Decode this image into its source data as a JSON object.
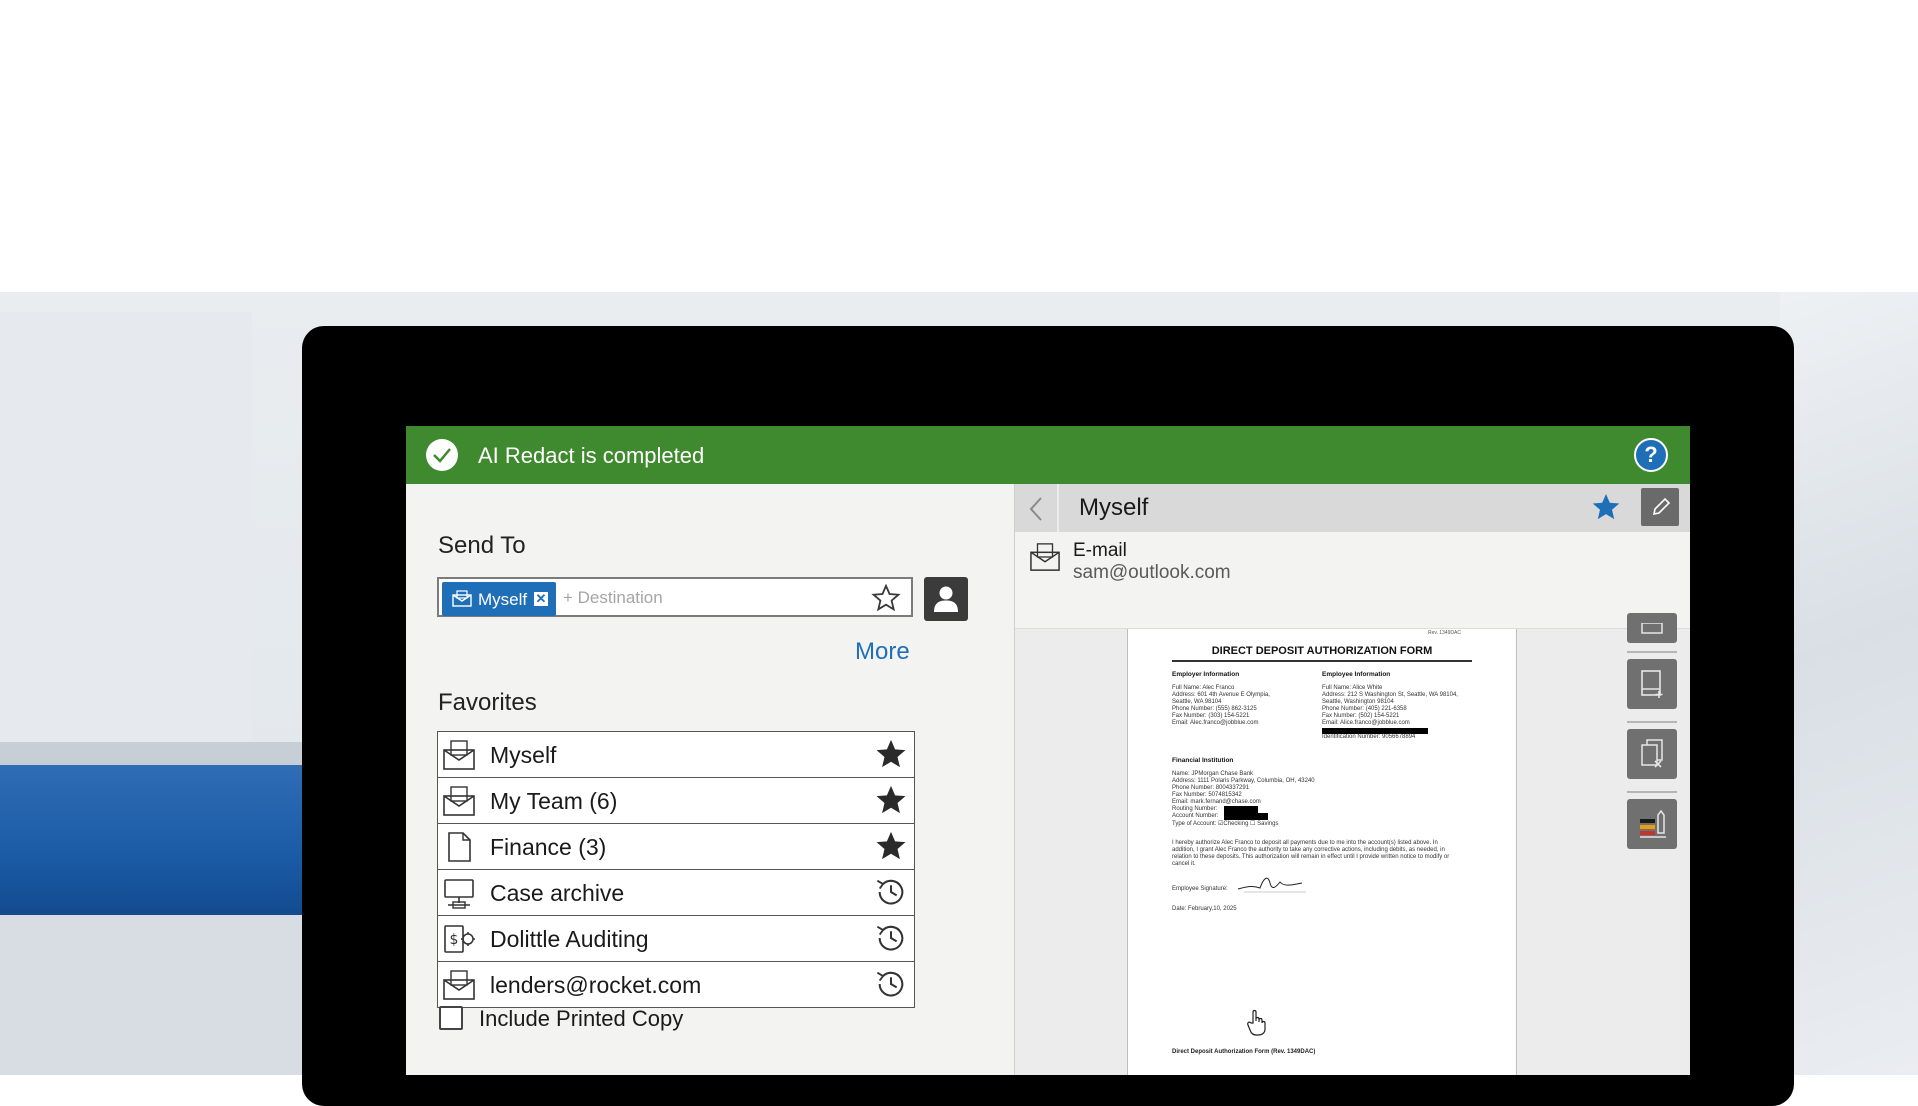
{
  "banner": {
    "message": "AI Redact is completed",
    "help_symbol": "?",
    "icon": "check-circle-icon",
    "color": "#3f8a2f"
  },
  "send_to": {
    "title": "Send To",
    "chip_label": "Myself",
    "chip_remove_symbol": "✕",
    "placeholder": "+ Destination",
    "more_label": "More"
  },
  "favorites": {
    "title": "Favorites",
    "items": [
      {
        "name": "Myself",
        "icon": "email-icon",
        "tail": "star-filled-icon"
      },
      {
        "name": "My Team (6)",
        "icon": "email-icon",
        "tail": "star-filled-icon"
      },
      {
        "name": "Finance (3)",
        "icon": "document-icon",
        "tail": "star-filled-icon"
      },
      {
        "name": "Case archive",
        "icon": "network-folder-icon",
        "tail": "history-icon"
      },
      {
        "name": "Dolittle Auditing",
        "icon": "payment-icon",
        "tail": "history-icon"
      },
      {
        "name": "lenders@rocket.com",
        "icon": "email-icon",
        "tail": "history-icon"
      }
    ]
  },
  "include_printed_copy": {
    "label": "Include Printed Copy",
    "checked": false
  },
  "detail": {
    "title": "Myself",
    "type": "E-mail",
    "address": "sam@outlook.com",
    "accent": "#1f6fb8"
  },
  "document": {
    "rev_top": "Rev. 1349DAC",
    "title": "DIRECT DEPOSIT AUTHORIZATION FORM",
    "employer_heading": "Employer Information",
    "employer_lines": [
      "Full Name: Alec Franco",
      "Address: 601 4th Avenue E Olympia,",
      "Seattle, WA 98104",
      "Phone Number: (555) 862-3125",
      "Fax Number: (303) 154-5221",
      "Email: Alec.franco@jobblue.com"
    ],
    "employee_heading": "Employee Information",
    "employee_lines": [
      "Full Name: Alice White",
      "Address: 212 S Washington St, Seattle, WA 98104,",
      "Seattle, Washington 98104",
      "Phone Number: (405) 221-6358",
      "Fax Number: (502) 154-5221",
      "Email: Alice.franco@jobblue.com",
      "",
      "Identification Number: 9056678894"
    ],
    "financial_heading": "Financial Institution",
    "financial_lines": [
      "Name: JPMorgan Chase Bank",
      "Address: 1111 Polaris Parkway, Columbia, OH, 43240",
      "Phone Number: 8004337291",
      "Fax Number: 5074815342",
      "Email: mark.fernand@chase.com",
      "Routing Number:",
      "Account Number:",
      "Type of Account: ☑Checking ☐ Savings"
    ],
    "auth_lines": [
      "I hereby authorize Alec Franco to deposit all payments due to me into the account(s) listed above. In",
      "addition, I grant Alec Franco the authority to take any corrective actions, including debits, as needed, in",
      "relation to these deposits. This authorization will remain in effect until I provide written notice to modify or",
      "cancel it."
    ],
    "signature_label": "Employee Signature:",
    "date_line": "Date: February,10, 2025",
    "footer": "Direct Deposit Authorization Form (Rev. 1349DAC)"
  }
}
